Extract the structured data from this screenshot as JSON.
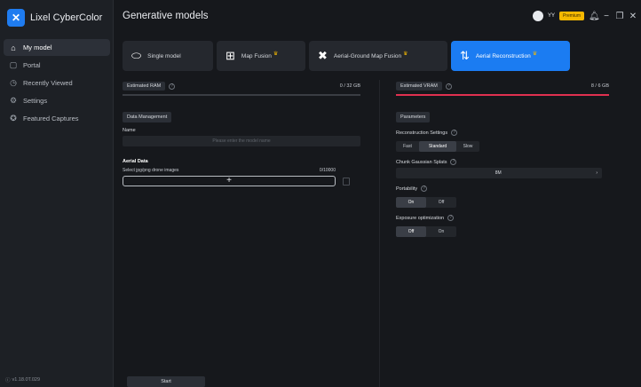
{
  "app": {
    "name": "Lixel CyberColor",
    "version": "v1.18.0T.029"
  },
  "sidebar": {
    "items": [
      {
        "label": "My model",
        "icon": "home-icon",
        "active": true
      },
      {
        "label": "Portal",
        "icon": "document-icon",
        "active": false
      },
      {
        "label": "Recently Viewed",
        "icon": "clock-icon",
        "active": false
      },
      {
        "label": "Settings",
        "icon": "gear-icon",
        "active": false
      },
      {
        "label": "Featured Captures",
        "icon": "star-badge-icon",
        "active": false
      }
    ]
  },
  "header": {
    "title": "Generative models",
    "user_tag": "YY",
    "premium_label": "Premium",
    "icons": [
      "bell-icon",
      "minimize-icon",
      "restore-icon",
      "close-icon"
    ]
  },
  "tabs": [
    {
      "label": "Single model",
      "icon": "single-model-icon",
      "premium": false,
      "active": false
    },
    {
      "label": "Map Fusion",
      "icon": "map-fusion-icon",
      "premium": true,
      "active": false
    },
    {
      "label": "Aerial-Ground Map Fusion",
      "icon": "aerial-ground-icon",
      "premium": true,
      "active": false
    },
    {
      "label": "Aerial Reconstruction",
      "icon": "drone-icon",
      "premium": true,
      "active": true
    }
  ],
  "left": {
    "ram_label": "Estimated RAM",
    "ram_value": "0 / 32 GB",
    "ram_fraction": 0.0,
    "data_management_label": "Data Management",
    "name_label": "Name",
    "name_placeholder": "Please enter the model name",
    "aerial_data_label": "Aerial Data",
    "drone_images_label": "Select jpg/png drone images",
    "drone_images_count": "0/10000",
    "add_symbol": "+",
    "start_label": "Start"
  },
  "right": {
    "vram_label": "Estimated VRAM",
    "vram_value": "8 / 6 GB",
    "vram_over_limit": true,
    "parameters_label": "Parameters",
    "recon_settings_label": "Reconstruction Settings",
    "recon_options": [
      "Fast",
      "Standard",
      "Slow"
    ],
    "recon_selected": "Standard",
    "chunk_label": "Chunk Gaussian Splats",
    "chunk_value": "8M",
    "portability_label": "Portability",
    "portability_options": [
      "On",
      "Off"
    ],
    "portability_selected": "On",
    "exposure_label": "Exposure optimization",
    "exposure_options": [
      "Off",
      "On"
    ],
    "exposure_selected": "Off"
  },
  "colors": {
    "accent": "#1b7cf2",
    "premium": "#f5b800",
    "warning_bar": "#e03050"
  }
}
